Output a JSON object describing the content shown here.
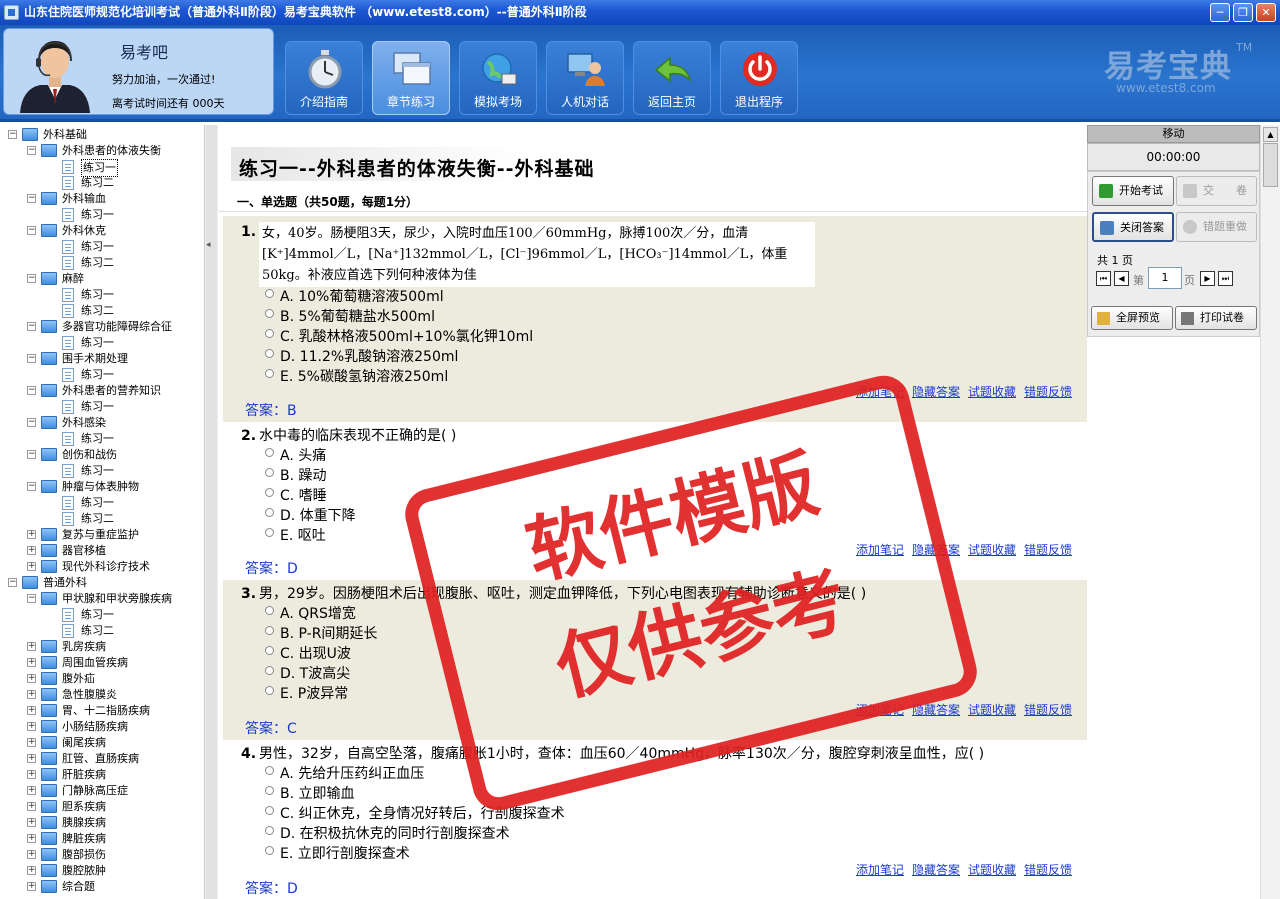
{
  "window": {
    "title": "山东住院医师规范化培训考试（普通外科Ⅱ阶段）易考宝典软件 （www.etest8.com）--普通外科Ⅱ阶段"
  },
  "profile": {
    "name": "易考吧",
    "slogan": "努力加油，一次通过!",
    "countdown": "离考试时间还有 000天"
  },
  "toolbar": {
    "buttons": [
      {
        "label": "介绍指南",
        "icon": "stopwatch-icon"
      },
      {
        "label": "章节练习",
        "icon": "windows-icon"
      },
      {
        "label": "模拟考场",
        "icon": "globe-icon"
      },
      {
        "label": "人机对话",
        "icon": "computer-user-icon"
      },
      {
        "label": "返回主页",
        "icon": "return-arrow-icon"
      },
      {
        "label": "退出程序",
        "icon": "power-icon"
      }
    ]
  },
  "brand": {
    "name": "易考宝典",
    "tm": "TM",
    "url": "www.etest8.com"
  },
  "tree": [
    {
      "level": 0,
      "type": "folder",
      "expander": "−",
      "label": "外科基础"
    },
    {
      "level": 1,
      "type": "folder",
      "expander": "−",
      "label": "外科患者的体液失衡"
    },
    {
      "level": 2,
      "type": "doc",
      "label": "练习一",
      "selected": true
    },
    {
      "level": 2,
      "type": "doc",
      "label": "练习二"
    },
    {
      "level": 1,
      "type": "folder",
      "expander": "−",
      "label": "外科输血"
    },
    {
      "level": 2,
      "type": "doc",
      "label": "练习一"
    },
    {
      "level": 1,
      "type": "folder",
      "expander": "−",
      "label": "外科休克"
    },
    {
      "level": 2,
      "type": "doc",
      "label": "练习一"
    },
    {
      "level": 2,
      "type": "doc",
      "label": "练习二"
    },
    {
      "level": 1,
      "type": "folder",
      "expander": "−",
      "label": "麻醉"
    },
    {
      "level": 2,
      "type": "doc",
      "label": "练习一"
    },
    {
      "level": 2,
      "type": "doc",
      "label": "练习二"
    },
    {
      "level": 1,
      "type": "folder",
      "expander": "−",
      "label": "多器官功能障碍综合征"
    },
    {
      "level": 2,
      "type": "doc",
      "label": "练习一"
    },
    {
      "level": 1,
      "type": "folder",
      "expander": "−",
      "label": "围手术期处理"
    },
    {
      "level": 2,
      "type": "doc",
      "label": "练习一"
    },
    {
      "level": 1,
      "type": "folder",
      "expander": "−",
      "label": "外科患者的营养知识"
    },
    {
      "level": 2,
      "type": "doc",
      "label": "练习一"
    },
    {
      "level": 1,
      "type": "folder",
      "expander": "−",
      "label": "外科感染"
    },
    {
      "level": 2,
      "type": "doc",
      "label": "练习一"
    },
    {
      "level": 1,
      "type": "folder",
      "expander": "−",
      "label": "创伤和战伤"
    },
    {
      "level": 2,
      "type": "doc",
      "label": "练习一"
    },
    {
      "level": 1,
      "type": "folder",
      "expander": "−",
      "label": "肿瘤与体表肿物"
    },
    {
      "level": 2,
      "type": "doc",
      "label": "练习一"
    },
    {
      "level": 2,
      "type": "doc",
      "label": "练习二"
    },
    {
      "level": 1,
      "type": "folder",
      "expander": "+",
      "label": "复苏与重症监护"
    },
    {
      "level": 1,
      "type": "folder",
      "expander": "+",
      "label": "器官移植"
    },
    {
      "level": 1,
      "type": "folder",
      "expander": "+",
      "label": "现代外科诊疗技术"
    },
    {
      "level": 0,
      "type": "folder",
      "expander": "−",
      "label": "普通外科"
    },
    {
      "level": 1,
      "type": "folder",
      "expander": "−",
      "label": "甲状腺和甲状旁腺疾病"
    },
    {
      "level": 2,
      "type": "doc",
      "label": "练习一"
    },
    {
      "level": 2,
      "type": "doc",
      "label": "练习二"
    },
    {
      "level": 1,
      "type": "folder",
      "expander": "+",
      "label": "乳房疾病"
    },
    {
      "level": 1,
      "type": "folder",
      "expander": "+",
      "label": "周围血管疾病"
    },
    {
      "level": 1,
      "type": "folder",
      "expander": "+",
      "label": "腹外疝"
    },
    {
      "level": 1,
      "type": "folder",
      "expander": "+",
      "label": "急性腹膜炎"
    },
    {
      "level": 1,
      "type": "folder",
      "expander": "+",
      "label": "胃、十二指肠疾病"
    },
    {
      "level": 1,
      "type": "folder",
      "expander": "+",
      "label": "小肠结肠疾病"
    },
    {
      "level": 1,
      "type": "folder",
      "expander": "+",
      "label": "阑尾疾病"
    },
    {
      "level": 1,
      "type": "folder",
      "expander": "+",
      "label": "肛管、直肠疾病"
    },
    {
      "level": 1,
      "type": "folder",
      "expander": "+",
      "label": "肝脏疾病"
    },
    {
      "level": 1,
      "type": "folder",
      "expander": "+",
      "label": "门静脉高压症"
    },
    {
      "level": 1,
      "type": "folder",
      "expander": "+",
      "label": "胆系疾病"
    },
    {
      "level": 1,
      "type": "folder",
      "expander": "+",
      "label": "胰腺疾病"
    },
    {
      "level": 1,
      "type": "folder",
      "expander": "+",
      "label": "脾脏疾病"
    },
    {
      "level": 1,
      "type": "folder",
      "expander": "+",
      "label": "腹部损伤"
    },
    {
      "level": 1,
      "type": "folder",
      "expander": "+",
      "label": "腹腔脓肿"
    },
    {
      "level": 1,
      "type": "folder",
      "expander": "+",
      "label": "综合题"
    }
  ],
  "exercise": {
    "title": "练习一--外科患者的体液失衡--外科基础",
    "section": "一、单选题（共50题，每题1分）",
    "links": [
      "添加笔记",
      "隐藏答案",
      "试题收藏",
      "错题反馈"
    ],
    "questions": [
      {
        "num": "1.",
        "text": "女，40岁。肠梗阻3天，尿少，入院时血压100／60mmHg，脉搏100次／分，血清[K⁺]4mmol／L，[Na⁺]132mmol／L，[Cl⁻]96mmol／L，[HCO₃⁻]14mmol／L，体重50kg。补液应首选下列何种液体为佳",
        "options": [
          "A. 10%葡萄糖溶液500ml",
          "B. 5%葡萄糖盐水500ml",
          "C. 乳酸林格液500ml+10%氯化钾10ml",
          "D. 11.2%乳酸钠溶液250ml",
          "E. 5%碳酸氢钠溶液250ml"
        ],
        "answer": "答案：B"
      },
      {
        "num": "2.",
        "text": "水中毒的临床表现不正确的是(  )",
        "options": [
          "A. 头痛",
          "B. 躁动",
          "C. 嗜睡",
          "D. 体重下降",
          "E. 呕吐"
        ],
        "answer": "答案：D"
      },
      {
        "num": "3.",
        "text": "男，29岁。因肠梗阻术后出现腹胀、呕吐，测定血钾降低，下列心电图表现有辅助诊断意义的是(  )",
        "options": [
          "A. QRS增宽",
          "B. P-R间期延长",
          "C. 出现U波",
          "D. T波高尖",
          "E. P波异常"
        ],
        "answer": "答案：C"
      },
      {
        "num": "4.",
        "text": "男性，32岁，自高空坠落，腹痛腹胀1小时，查体：血压60／40mmHg，脉率130次／分，腹腔穿刺液呈血性，应(  )",
        "options": [
          "A. 先给升压药纠正血压",
          "B. 立即输血",
          "C. 纠正休克，全身情况好转后，行剖腹探查术",
          "D. 在积极抗休克的同时行剖腹探查术",
          "E. 立即行剖腹探查术"
        ],
        "answer": "答案：D"
      }
    ]
  },
  "watermark": {
    "line1": "软件模版",
    "line2": "仅供参考"
  },
  "right_panel": {
    "header": "移动",
    "timer": "00:00:00",
    "start_exam": "开始考试",
    "submit": "交　　卷",
    "close_answer": "关闭答案",
    "redo_wrong": "错题重做",
    "total_pages": "共 1 页",
    "page_prefix": "第",
    "page_value": "1",
    "page_suffix": "页",
    "fullscreen": "全屏预览",
    "print": "打印试卷"
  }
}
